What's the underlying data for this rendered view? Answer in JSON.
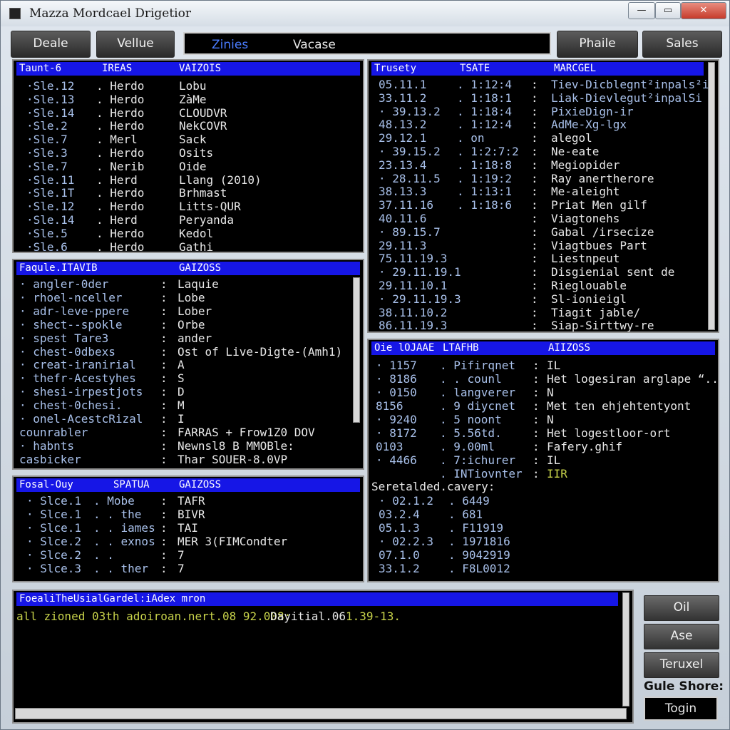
{
  "app": {
    "title": "Mazza Mordcael Drigetior"
  },
  "window_controls": {
    "minimize": "—",
    "maximize": "▭",
    "close": "✕"
  },
  "toolbar": {
    "deale": "Deale",
    "vellue": "Vellue",
    "phaile": "Phaile",
    "sales": "Sales"
  },
  "tabs": {
    "zinies": "Zinies",
    "vacase": "Vacase"
  },
  "panel1": {
    "headers": [
      "Taunt-6",
      "IREAS",
      "VAIZOIS"
    ],
    "rows": [
      [
        "·Sle.12",
        ". Herdo",
        "Lobu"
      ],
      [
        "·Sle.13",
        ". Herdo",
        "ZàMe"
      ],
      [
        "·Sle.14",
        ". Herdo",
        "CLOUDVR"
      ],
      [
        "·Sle.2",
        ". Herdo",
        "NekCOVR"
      ],
      [
        "·Sle.7",
        ". Merl",
        "Sack"
      ],
      [
        "·Sle.3",
        ". Herdo",
        "Osits"
      ],
      [
        "·Sle.7",
        ". Nerib",
        "Oide"
      ],
      [
        "·Sle.11",
        ". Herd",
        "Llang (2010)"
      ],
      [
        "·Sle.1T",
        ". Herdo",
        "Brhmast"
      ],
      [
        "·Sle.12",
        ". Herdo",
        "Litts-QUR"
      ],
      [
        "·Sle.14",
        ". Herd",
        "Peryanda"
      ],
      [
        "·Sle.5",
        ". Herdo",
        "Kedol"
      ],
      [
        "·Sle.6",
        ". Herdo",
        "Gathi"
      ]
    ]
  },
  "panel2": {
    "headers": [
      "Trusety",
      "TSATE",
      "MARCGEL"
    ],
    "rows": [
      [
        "05.11.1",
        ". 1:12:4",
        "Tiev-Dicblegnt²inpals²i"
      ],
      [
        "33.11.2",
        ". 1:18:1",
        "Liak-Dievlegut²inpalSi"
      ],
      [
        "· 39.13.2",
        ". 1:18:4",
        "PixieDign-ir"
      ],
      [
        "48.13.2",
        ". 1:12:4",
        "AdMe-Xg-lgx"
      ],
      [
        "29.12.1",
        ". on",
        "alegol"
      ],
      [
        "· 39.15.2",
        ". 1:2:7:2",
        "Ne-eate"
      ],
      [
        "23.13.4",
        ". 1:18:8",
        "Megiopider"
      ],
      [
        "· 28.11.5",
        ". 1:19:2",
        "Ray anertherore"
      ],
      [
        "38.13.3",
        ". 1:13:1",
        "Me-aleight"
      ],
      [
        "37.11.16",
        ". 1:18:6",
        "Priat Men gilf"
      ],
      [
        "40.11.6",
        "",
        "Viagtonehs"
      ],
      [
        "· 89.15.7",
        "",
        "Gabal /irsecize"
      ],
      [
        "29.11.3",
        "",
        "Viagtbues Part"
      ],
      [
        "75.11.19.3",
        "",
        "Liestnpeut"
      ],
      [
        "· 29.11.19.1",
        "",
        "Disgienial sent de"
      ],
      [
        "29.11.10.1",
        "",
        "Rieglouable"
      ],
      [
        "· 29.11.19.3",
        "",
        "Sl-ionieigl"
      ],
      [
        "38.11.10.2",
        "",
        "Tiagit jable/"
      ],
      [
        "86.11.19.3",
        "",
        "Siap-Sirttwy-re"
      ]
    ]
  },
  "panel3": {
    "headers": [
      "Faqule.ITAVIB",
      "GAIZOSS"
    ],
    "rows": [
      [
        "· angler-0der",
        "Laquie"
      ],
      [
        "· rhoel-nceller",
        "Lobe"
      ],
      [
        "· adr-leve-ppere",
        "Lober"
      ],
      [
        "· shect--spokle",
        "Orbe"
      ],
      [
        "· spest Tare3",
        "ander"
      ],
      [
        "· chest-0dbexs",
        "Ost of Live-Digte-(Amh1)"
      ],
      [
        "· creat-iranirial",
        "A"
      ],
      [
        "· thefr-Acestyhes",
        "S"
      ],
      [
        "· shesi-irpestjots",
        "D"
      ],
      [
        "· chest-0chesi.",
        "M"
      ],
      [
        "· onel-AcestcRizal",
        "I"
      ],
      [
        "counrabler",
        "FARRAS + Frow1Z0 DOV"
      ],
      [
        "· habnts",
        "Newnsl8 B MMOBle:"
      ],
      [
        "casbicker",
        "Thar SOUER-8.0VP"
      ]
    ]
  },
  "panel4": {
    "headers": [
      "Oie lOJAAE",
      "LTAFHB",
      "AIIZOSS"
    ],
    "rows": [
      [
        "· 1157",
        ". Pifirqnet",
        "IL"
      ],
      [
        "· 8186",
        ". . counl",
        "Het logesiran arglape “.."
      ],
      [
        "· 0150",
        ". langverer",
        "N"
      ],
      [
        "8156",
        ". 9 diycnet",
        "Met ten ehjehtentyont"
      ],
      [
        "· 9240",
        ". 5 noont",
        "N"
      ],
      [
        "· 8172",
        ". 5.56td.",
        "Het logestloor-ort"
      ],
      [
        "0103",
        ". 9.00ml",
        "Fafery.ghif"
      ],
      [
        "· 4466",
        ". 7:ichurer",
        "IL"
      ],
      [
        "",
        ". INTiovnter",
        "IIR"
      ]
    ],
    "subheading": "Seretalded.cavery:",
    "subrows": [
      [
        "· 02.1.2",
        ". 6449"
      ],
      [
        "03.2.4",
        ". 681"
      ],
      [
        "05.1.3",
        ". F11919"
      ],
      [
        "· 02.2.3",
        ". 1971816"
      ],
      [
        "07.1.0",
        ". 9042919"
      ],
      [
        "33.1.2",
        ". F8L0012"
      ]
    ]
  },
  "panel5": {
    "headers": [
      "Fosal-Ouy",
      "SPATUA",
      "GAIZOSS"
    ],
    "rows": [
      [
        "· Slce.1",
        ". Mobe",
        "TAFR"
      ],
      [
        "· Slce.1",
        ". . the",
        "BIVR"
      ],
      [
        "· Slce.1",
        ". . iames",
        "TAI"
      ],
      [
        "· Slce.2",
        ". . exnos",
        "MER 3(FIMCondter"
      ],
      [
        "· Slce.2",
        ". .",
        "7"
      ],
      [
        "· Slce.3",
        ". . ther",
        "7"
      ]
    ]
  },
  "log": {
    "header": "FoealiTheUsialGardel:iAdex mron",
    "line1_prefix": "all zioned 03th adoiroan.nert.08 92.008:",
    "line1_middle": "Dayitial.06",
    "line1_suffix": "1.39-13."
  },
  "side": {
    "oil": "Oil",
    "ase": "Ase",
    "teruxel": "Teruxel",
    "label": "Gule Shore:",
    "togin": "Togin"
  }
}
